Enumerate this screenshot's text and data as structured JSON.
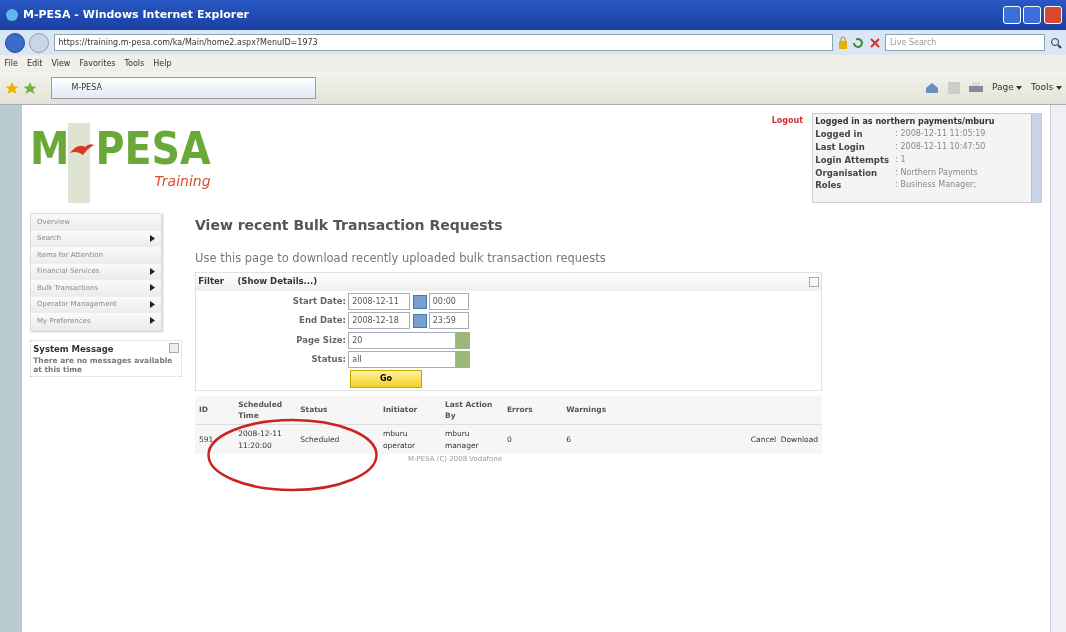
{
  "window": {
    "title": "M-PESA - Windows Internet Explorer"
  },
  "browser": {
    "address": "https://training.m-pesa.com/ka/Main/home2.aspx?MenuID=1973",
    "search_placeholder": "Live Search",
    "menu": [
      "File",
      "Edit",
      "View",
      "Favorites",
      "Tools",
      "Help"
    ],
    "tab": "M-PESA",
    "toolbar": [
      "Page",
      "Tools"
    ]
  },
  "logo": {
    "left": "M",
    "right": "PESA",
    "subtitle": "Training"
  },
  "logout": "Logout",
  "session": {
    "heading": "Logged in as northern payments/mburu",
    "rows": [
      {
        "label": "Logged in",
        "value": ": 2008-12-11 11:05:19"
      },
      {
        "label": "Last Login",
        "value": ": 2008-12-11 10:47:50"
      },
      {
        "label": "Login Attempts",
        "value": ": 1"
      },
      {
        "label": "Organisation",
        "value": ": Northern Payments"
      },
      {
        "label": "Roles",
        "value": ": Business Manager;"
      }
    ]
  },
  "sidebar": {
    "items": [
      {
        "label": "Overview",
        "has_submenu": false
      },
      {
        "label": "Search",
        "has_submenu": true
      },
      {
        "label": "Items for Attention",
        "has_submenu": false
      },
      {
        "label": "Financial Services",
        "has_submenu": true
      },
      {
        "label": "Bulk Transactions",
        "has_submenu": true
      },
      {
        "label": "Operator Management",
        "has_submenu": true
      },
      {
        "label": "My Preferences",
        "has_submenu": true
      }
    ]
  },
  "system_message": {
    "title": "System Message",
    "text": "There are no messages available at this time"
  },
  "heading": "View recent Bulk Transaction Requests",
  "description": "Use this page to download recently uploaded bulk transaction requests",
  "filter": {
    "title": "Filter",
    "toggle": "(Show Details...)",
    "fields": [
      {
        "kind": "datetime",
        "label": "Start Date:",
        "date": "2008-12-11",
        "time": "00:00"
      },
      {
        "kind": "datetime",
        "label": "End Date:",
        "date": "2008-12-18",
        "time": "23:59"
      },
      {
        "kind": "select",
        "label": "Page Size:",
        "value": "20"
      },
      {
        "kind": "select",
        "label": "Status:",
        "value": "all"
      }
    ],
    "button": "Go"
  },
  "table": {
    "columns": [
      "ID",
      "Scheduled Time",
      "Status",
      "Initiator",
      "Last Action By",
      "Errors",
      "Warnings"
    ],
    "rows": [
      {
        "cells": [
          "591",
          "2008-12-11 11:20:00",
          "Scheduled",
          "mburu operator",
          "mburu manager",
          "0",
          "6"
        ],
        "actions": [
          "Cancel",
          "Download"
        ]
      }
    ]
  },
  "footer": "M-PESA (C) 2008 Vodafone"
}
